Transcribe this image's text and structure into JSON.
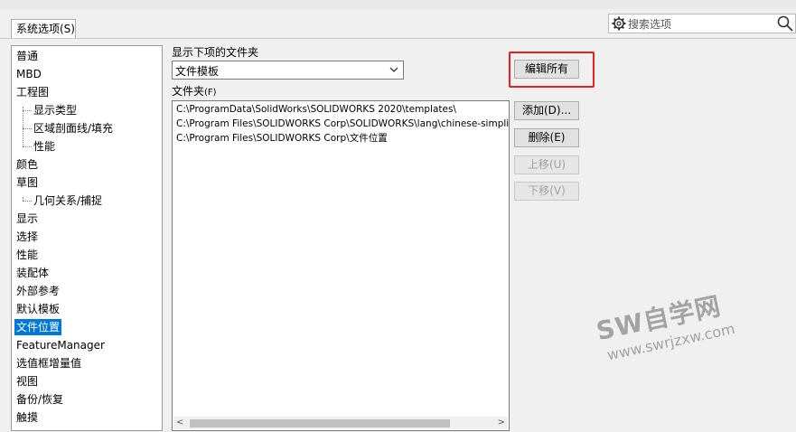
{
  "tab": {
    "label": "系统选项(S)"
  },
  "search": {
    "placeholder": "搜索选项"
  },
  "tree": {
    "items": [
      {
        "label": "普通"
      },
      {
        "label": "MBD"
      },
      {
        "label": "工程图"
      },
      {
        "label": "显示类型"
      },
      {
        "label": "区域剖面线/填充"
      },
      {
        "label": "性能"
      },
      {
        "label": "颜色"
      },
      {
        "label": "草图"
      },
      {
        "label": "几何关系/捕捉"
      },
      {
        "label": "显示"
      },
      {
        "label": "选择"
      },
      {
        "label": "性能"
      },
      {
        "label": "装配体"
      },
      {
        "label": "外部参考"
      },
      {
        "label": "默认模板"
      },
      {
        "label": "文件位置"
      },
      {
        "label": "FeatureManager"
      },
      {
        "label": "选值框增量值"
      },
      {
        "label": "视图"
      },
      {
        "label": "备份/恢复"
      },
      {
        "label": "触摸"
      }
    ],
    "selected": "文件位置"
  },
  "folder_type": {
    "label": "显示下项的文件夹",
    "value": "文件模板"
  },
  "folders": {
    "label": "文件夹",
    "hotkey": "(F)",
    "paths": [
      "C:\\ProgramData\\SolidWorks\\SOLIDWORKS 2020\\templates\\",
      "C:\\Program Files\\SOLIDWORKS Corp\\SOLIDWORKS\\lang\\chinese-simplifi",
      "C:\\Program Files\\SOLIDWORKS Corp\\文件位置"
    ]
  },
  "buttons": {
    "edit_all": "编辑所有",
    "add": "添加(D)...",
    "delete": "删除(E)",
    "move_up": "上移(U)",
    "move_down": "下移(V)"
  },
  "watermark": {
    "title": "SW自学网",
    "url": "www.swrjzxw.com"
  },
  "colors": {
    "selection": "#0078d7",
    "highlight_box": "#e52020"
  }
}
